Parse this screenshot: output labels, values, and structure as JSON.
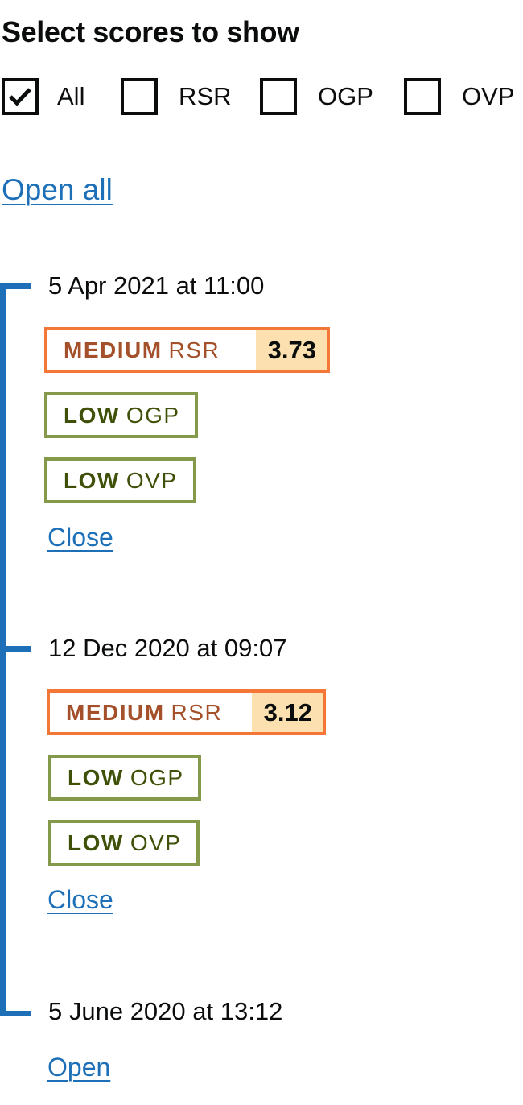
{
  "heading": "Select scores to show",
  "filters": [
    {
      "label": "All",
      "checked": true
    },
    {
      "label": "RSR",
      "checked": false
    },
    {
      "label": "OGP",
      "checked": false
    },
    {
      "label": "OVP",
      "checked": false
    }
  ],
  "open_all_label": "Open all",
  "timeline": [
    {
      "date": "5 Apr 2021 at 11:00",
      "rsr": {
        "level": "MEDIUM",
        "name": "RSR",
        "score": "3.73"
      },
      "ogp": {
        "level": "LOW",
        "name": "OGP"
      },
      "ovp": {
        "level": "LOW",
        "name": "OVP"
      },
      "toggle_label": "Close"
    },
    {
      "date": "12 Dec 2020 at 09:07",
      "rsr": {
        "level": "MEDIUM",
        "name": "RSR",
        "score": "3.12"
      },
      "ogp": {
        "level": "LOW",
        "name": "OGP"
      },
      "ovp": {
        "level": "LOW",
        "name": "OVP"
      },
      "toggle_label": "Close"
    },
    {
      "date": "5 June 2020 at 13:12",
      "toggle_label": "Open"
    }
  ],
  "colors": {
    "link": "#1d70b8",
    "timeline": "#1d70b8",
    "medium_border": "#f47738",
    "medium_text": "#a4512b",
    "score_bg": "#fce0af",
    "low_border": "#85994b",
    "low_text": "#3f5008"
  }
}
